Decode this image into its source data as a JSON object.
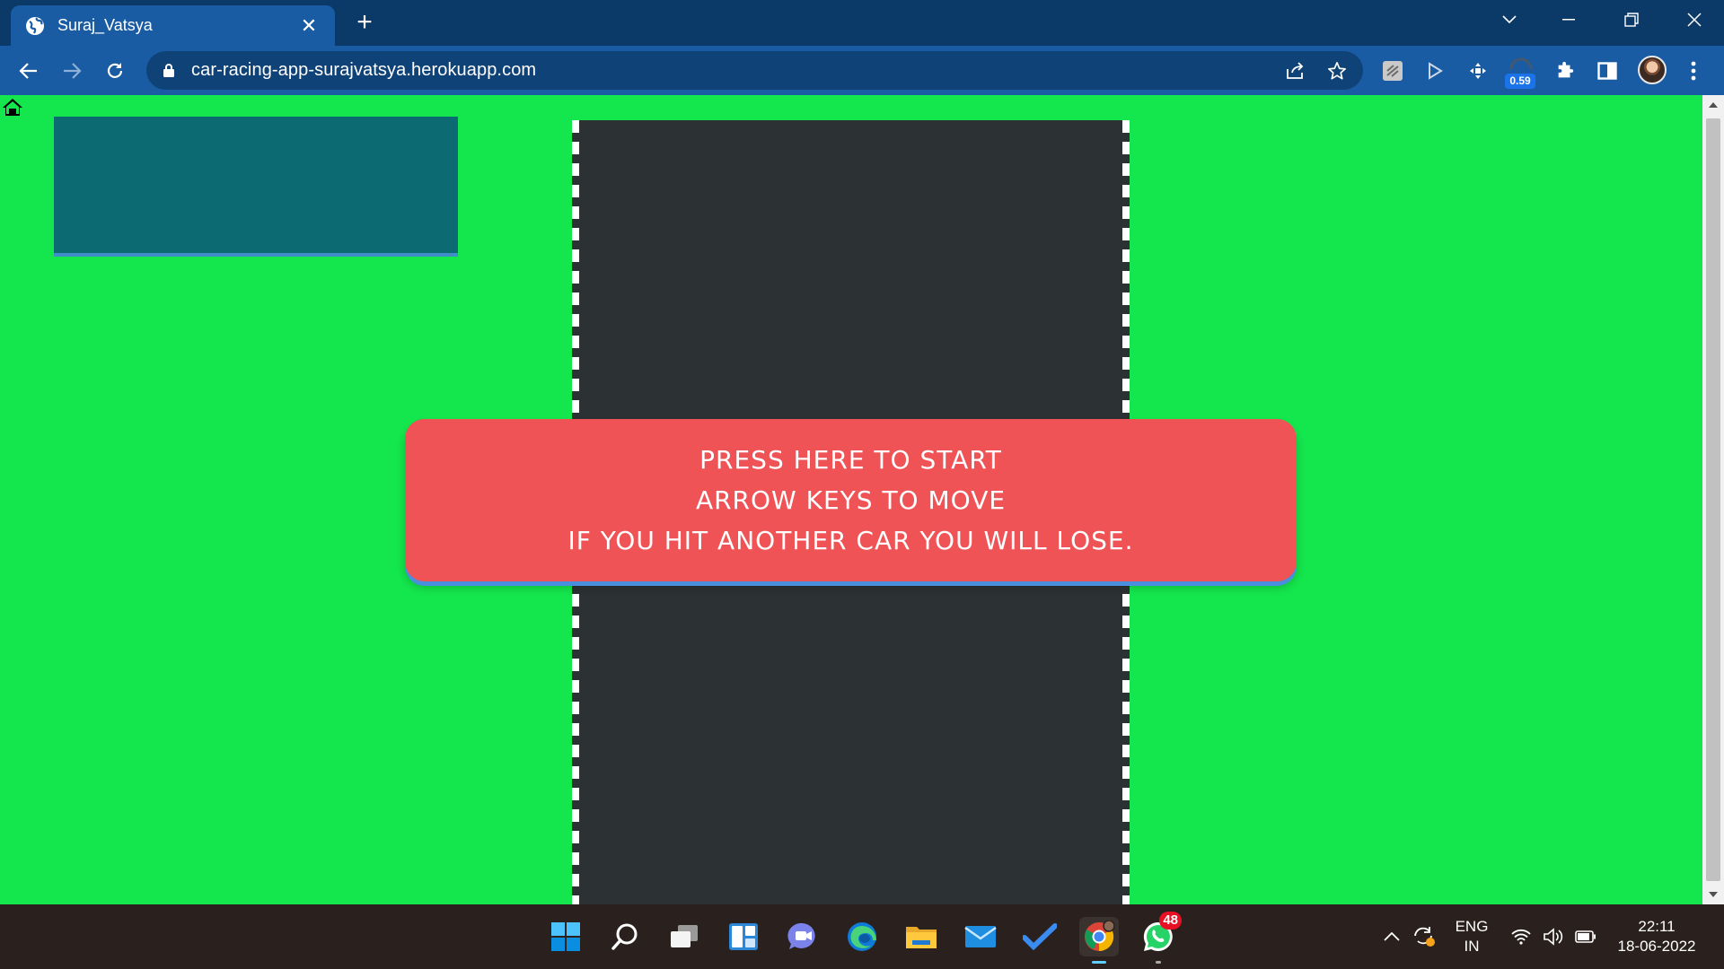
{
  "browser": {
    "tab": {
      "title": "Suraj_Vatsya"
    },
    "address": {
      "url": "car-racing-app-surajvatsya.herokuapp.com"
    },
    "extensions": {
      "badge_value": "0.59"
    }
  },
  "page": {
    "background_color": "#14e64d",
    "road_color": "#2c3134",
    "score_panel_color": "#0c6b72",
    "start_button_color": "#ef5356",
    "start_instructions": [
      "PRESS HERE TO START",
      "ARROW KEYS TO MOVE",
      "IF YOU HIT ANOTHER CAR YOU WILL LOSE."
    ]
  },
  "taskbar": {
    "apps": [
      "windows-start",
      "search",
      "task-view",
      "widgets",
      "chat",
      "edge",
      "file-explorer",
      "mail",
      "todo",
      "chrome",
      "whatsapp"
    ],
    "whatsapp_badge": "48",
    "language": {
      "line1": "ENG",
      "line2": "IN"
    },
    "clock": {
      "time": "22:11",
      "date": "18-06-2022"
    }
  }
}
